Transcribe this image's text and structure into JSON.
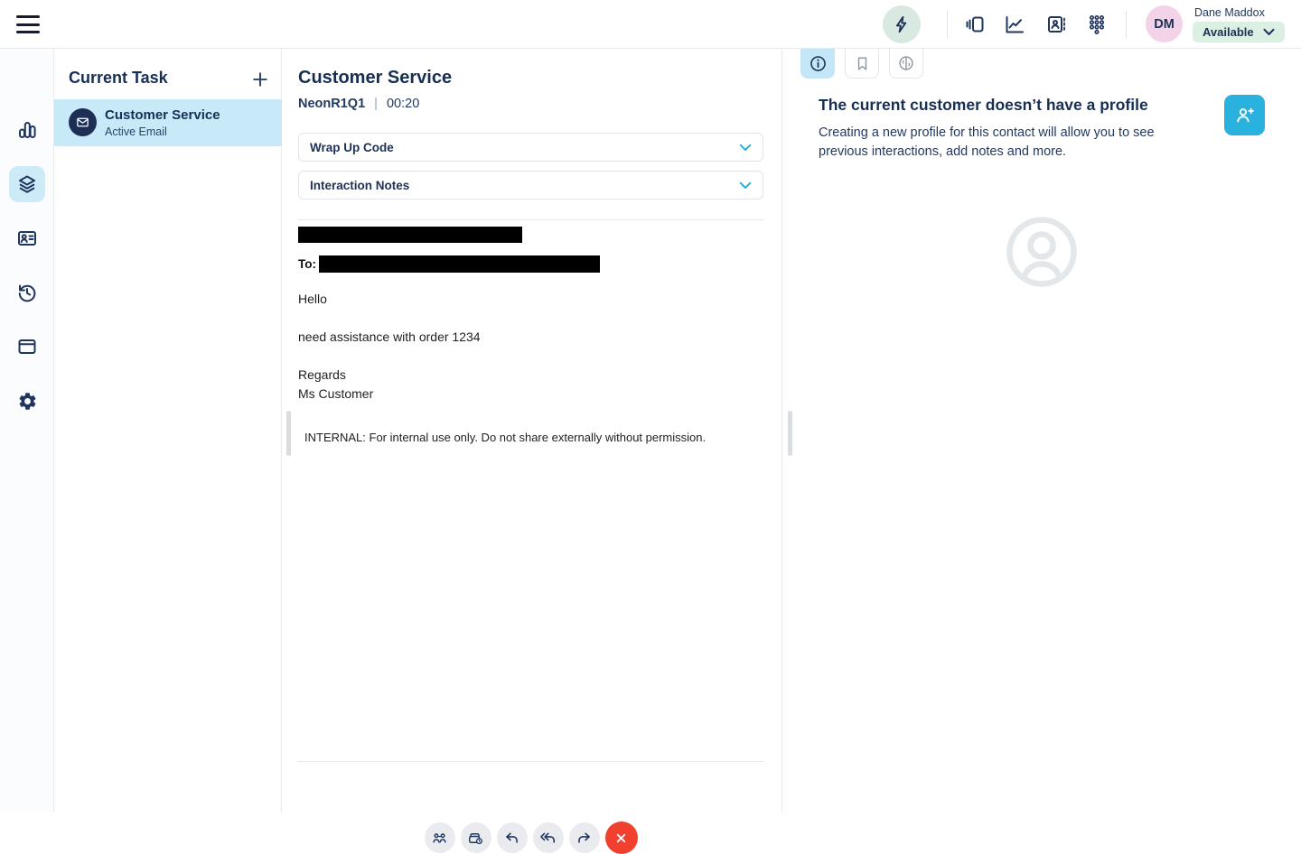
{
  "topbar": {
    "user_initials": "DM",
    "user_name": "Dane Maddox",
    "status_label": "Available"
  },
  "task_panel": {
    "title": "Current Task",
    "task_title": "Customer Service",
    "task_subtitle": "Active Email"
  },
  "interaction": {
    "title": "Customer Service",
    "queue": "NeonR1Q1",
    "separator": "|",
    "timer": "00:20",
    "wrap_up_label": "Wrap Up Code",
    "notes_label": "Interaction Notes",
    "email_to_label": "To:",
    "email_lines": [
      "Hello",
      "need assistance with order 1234",
      "Regards",
      "Ms Customer"
    ],
    "internal_note": "INTERNAL: For internal use only. Do not share externally without permission."
  },
  "profile_panel": {
    "heading": "The current customer doesn’t have a profile",
    "body": "Creating a new profile for this contact will allow you to see previous interactions, add notes and more."
  },
  "colors": {
    "accent_cyan": "#29b2de",
    "highlight_blue": "#c7e9f8",
    "selected_rail_blue": "#cdeaf8",
    "mint_green": "#d8e9e2",
    "avatar_pink": "#f2d3e7",
    "status_green": "#dcefe3",
    "navy": "#233a60",
    "danger_red": "#f2402f",
    "redacted_black": "#000000"
  }
}
